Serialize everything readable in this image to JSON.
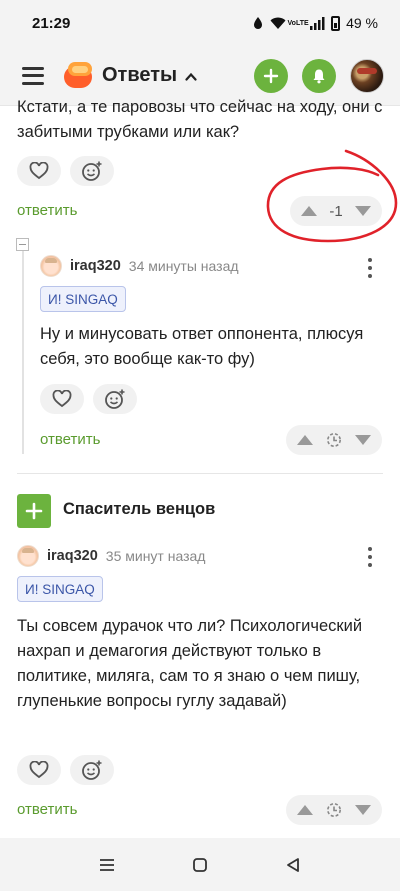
{
  "status_bar": {
    "time": "21:29",
    "network_label": "VoLTE",
    "battery": "49 %"
  },
  "header": {
    "title": "Ответы"
  },
  "previous_comment": {
    "text": "Кстати, а те паровозы что сейчас на ходу, они с забитыми трубками или как?",
    "reply_label": "ответить",
    "vote_count": "-1"
  },
  "comment_1": {
    "author": "iraq320",
    "time": "34 минуты назад",
    "tag": "И! SINGAQ",
    "text": "Ну и минусовать ответ оппонента, плюсуя себя, это вообще как-то фу)",
    "reply_label": "ответить"
  },
  "story": {
    "title": "Спаситель венцов"
  },
  "comment_2": {
    "author": "iraq320",
    "time": "35 минут назад",
    "tag": "И! SINGAQ",
    "text": "Ты совсем дурачок что ли? Психологический нахрап и демагогия действуют только в политике, миляга, сам то я знаю о чем пишу, глупенькие вопросы гуглу задавай)",
    "reply_label": "ответить"
  },
  "colors": {
    "accent_green": "#6cb33e",
    "reply_green": "#5a9b2e",
    "annotation_red": "#e0222a",
    "tag_blue": "#3b56a8"
  },
  "icons": [
    "heart-icon",
    "emoji-add-icon",
    "arrow-up-icon",
    "arrow-down-icon",
    "clock-icon",
    "plus-icon",
    "bell-icon",
    "chevron-up-icon",
    "menu-icon",
    "kebab-icon"
  ]
}
